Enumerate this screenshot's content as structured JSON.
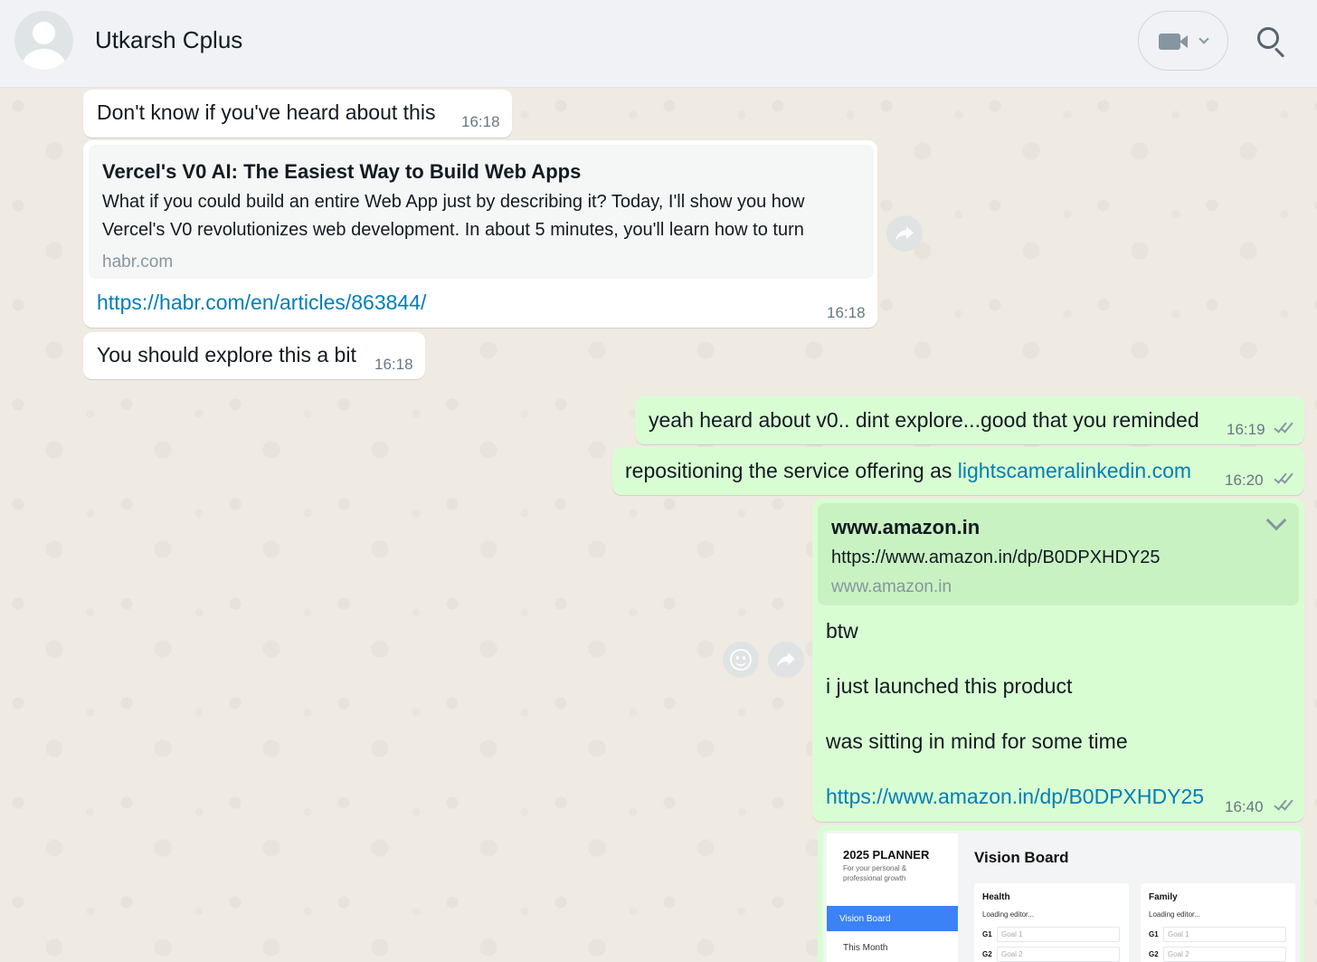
{
  "header": {
    "contact_name": "Utkarsh Cplus",
    "avatar_icon": "default-avatar-icon",
    "video_call_icon": "video-camera-icon",
    "search_icon": "search-icon"
  },
  "messages": [
    {
      "direction": "in",
      "text": "Don't know if you've heard about this",
      "time": "16:18"
    },
    {
      "direction": "in",
      "preview": {
        "title": "Vercel's V0 AI: The Easiest Way to Build Web Apps",
        "description": "What if you could build an entire Web App just by describing it? Today, I'll show you how Vercel's V0 revolutionizes web development. In about 5 minutes, you'll learn how to turn",
        "domain": "habr.com"
      },
      "link": "https://habr.com/en/articles/863844/",
      "time": "16:18"
    },
    {
      "direction": "in",
      "text": "You should explore this a bit",
      "time": "16:18"
    },
    {
      "direction": "out",
      "text": "yeah heard about v0.. dint explore...good that you reminded",
      "time": "16:19",
      "status": "read"
    },
    {
      "direction": "out",
      "text_prefix": "repositioning the service offering as ",
      "link": "lightscameralinkedin.com",
      "time": "16:20",
      "status": "read"
    },
    {
      "direction": "out",
      "preview": {
        "title": "www.amazon.in",
        "description": "https://www.amazon.in/dp/B0DPXHDY25",
        "domain": "www.amazon.in"
      },
      "lines": [
        "btw",
        "i just launched this product",
        "was sitting in mind for some time"
      ],
      "link": "https://www.amazon.in/dp/B0DPXHDY25",
      "time": "16:40",
      "status": "read"
    }
  ],
  "planner_image": {
    "title": "2025 PLANNER",
    "subtitle": "For your personal & professional growth",
    "nav_active": "Vision Board",
    "nav_item": "This Month",
    "heading": "Vision Board",
    "cards": [
      {
        "title": "Health",
        "status": "Loading editor...",
        "goals": [
          {
            "label": "G1",
            "placeholder": "Goal 1"
          },
          {
            "label": "G2",
            "placeholder": "Goal 2"
          }
        ]
      },
      {
        "title": "Family",
        "status": "Loading editor...",
        "goals": [
          {
            "label": "G1",
            "placeholder": "Goal 1"
          },
          {
            "label": "G2",
            "placeholder": "Goal 2"
          }
        ]
      }
    ]
  },
  "icons": {
    "forward": "forward-arrow-icon",
    "emoji": "emoji-smiley-icon",
    "menu_chevron": "chevron-down-icon",
    "read_receipt": "double-check-icon"
  },
  "colors": {
    "incoming_bubble": "#ffffff",
    "outgoing_bubble": "#d9fdd3",
    "link": "#027eb5",
    "chat_background": "#efeae2",
    "header_background": "#f0f2f5"
  }
}
